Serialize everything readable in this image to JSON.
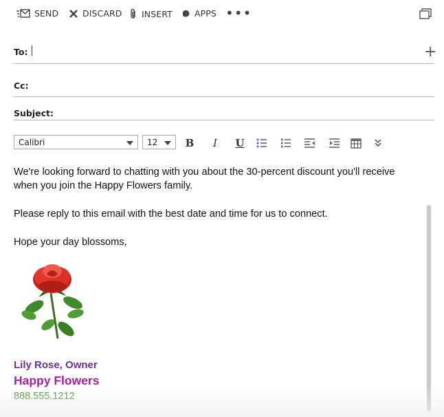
{
  "toolbar": {
    "send_label": "SEND",
    "discard_label": "DISCARD",
    "insert_label": "INSERT",
    "apps_label": "APPS",
    "more_label": "•••"
  },
  "fields": {
    "to_label": "To:",
    "to_value": "",
    "cc_label": "Cc:",
    "cc_value": "",
    "subject_label": "Subject:",
    "subject_value": ""
  },
  "format": {
    "font": "Calibri",
    "size": "12",
    "bold": "B",
    "italic": "I",
    "underline": "U"
  },
  "message": {
    "paragraph1_line1": "We're looking forward to chatting with you about the 30-percent discount you'll receive",
    "paragraph1_line2": "when you join the Happy Flowers family.",
    "paragraph2": "Please reply to this email with the best date and time for us to connect.",
    "closing": "Hope your day blossoms,"
  },
  "signature": {
    "name": "Lily Rose, Owner",
    "company": "Happy Flowers",
    "phone": "888.555.1212",
    "name_color": "#6b2fa0",
    "company_color": "#b01ea0",
    "phone_color": "#3f8f24"
  }
}
